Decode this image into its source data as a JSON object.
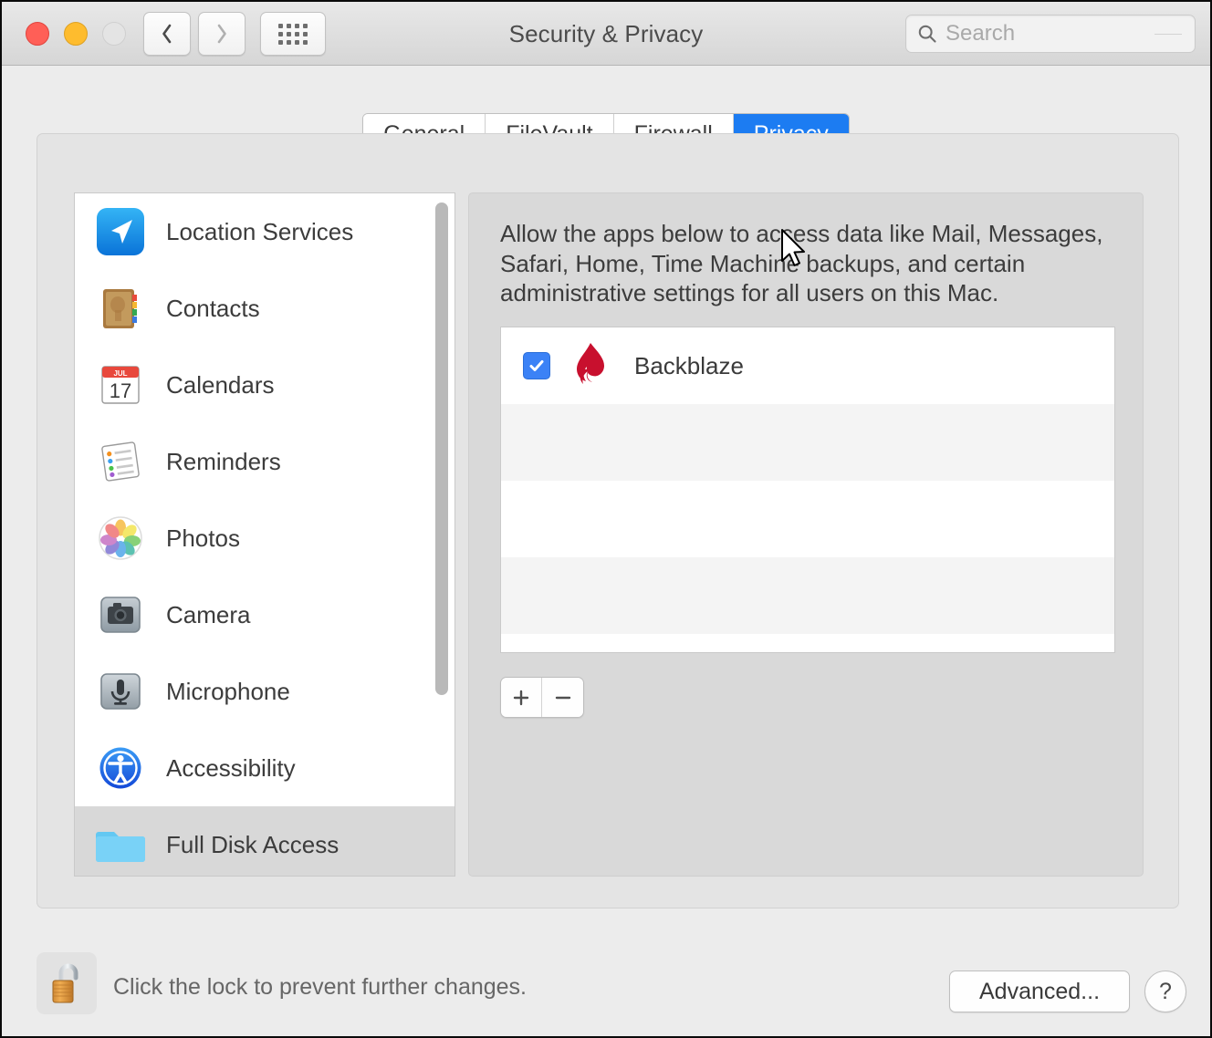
{
  "window": {
    "title": "Security & Privacy",
    "traffic_lights": [
      "close",
      "minimize",
      "zoom"
    ],
    "nav": {
      "back": "back",
      "forward": "forward",
      "show_all": "show-all-grid"
    }
  },
  "search": {
    "placeholder": "Search",
    "value": ""
  },
  "tabs": [
    {
      "label": "General",
      "active": false
    },
    {
      "label": "FileVault",
      "active": false
    },
    {
      "label": "Firewall",
      "active": false
    },
    {
      "label": "Privacy",
      "active": true
    }
  ],
  "sidebar": {
    "items": [
      {
        "label": "Location Services",
        "icon": "location-arrow-icon",
        "selected": false
      },
      {
        "label": "Contacts",
        "icon": "contacts-book-icon",
        "selected": false
      },
      {
        "label": "Calendars",
        "icon": "calendar-icon",
        "selected": false
      },
      {
        "label": "Reminders",
        "icon": "reminders-list-icon",
        "selected": false
      },
      {
        "label": "Photos",
        "icon": "photos-pinwheel-icon",
        "selected": false
      },
      {
        "label": "Camera",
        "icon": "camera-icon",
        "selected": false
      },
      {
        "label": "Microphone",
        "icon": "microphone-icon",
        "selected": false
      },
      {
        "label": "Accessibility",
        "icon": "accessibility-icon",
        "selected": false
      },
      {
        "label": "Full Disk Access",
        "icon": "blue-folder-icon",
        "selected": true
      }
    ]
  },
  "main": {
    "description": "Allow the apps below to access data like Mail, Messages, Safari, Home, Time Machine backups, and certain administrative settings for all users on this Mac.",
    "apps": [
      {
        "name": "Backblaze",
        "checked": true,
        "icon": "backblaze-flame-icon"
      }
    ],
    "add_label": "+",
    "remove_label": "−"
  },
  "footer": {
    "lock_icon": "unlocked-padlock-icon",
    "lock_message": "Click the lock to prevent further changes.",
    "advanced_label": "Advanced...",
    "help_label": "?"
  },
  "colors": {
    "accent_blue": "#1c7cf2",
    "checkbox_blue": "#3b82f6",
    "backblaze_red": "#c8102e",
    "folder_blue": "#63c8f2",
    "window_chrome": "#e8e8e8",
    "panel_bg": "#e4e4e4",
    "selected_row": "#d8d8d8"
  }
}
